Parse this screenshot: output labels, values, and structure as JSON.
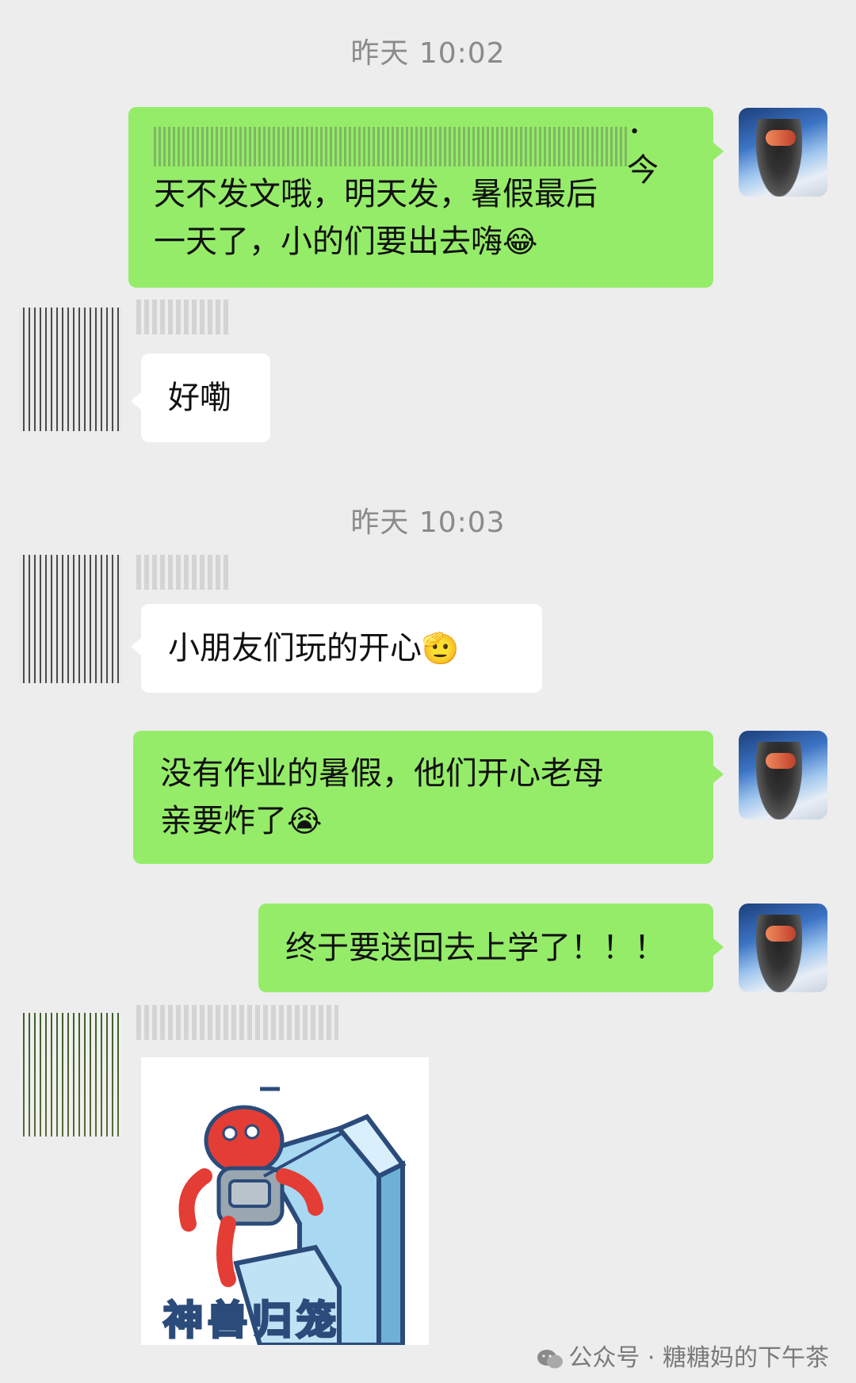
{
  "timestamps": [
    "昨天 10:02",
    "昨天 10:03"
  ],
  "messages": [
    {
      "sender": "me",
      "text": "今天不发文哦，明天发，暑假最后一天了，小的们要出去嗨",
      "lines": [
        "．今",
        "天不发文哦，明天发，暑假最后",
        "一天了，小的们要出去嗨"
      ],
      "emoji": "😂"
    },
    {
      "sender": "friend",
      "text": "好嘞"
    },
    {
      "sender": "friend",
      "text": "小朋友们玩的开心",
      "emoji": "🫡"
    },
    {
      "sender": "me",
      "lines": [
        "没有作业的暑假，他们开心老母",
        "亲要炸了"
      ],
      "emoji": "😭"
    },
    {
      "sender": "me",
      "text": "终于要送回去上学了！！！"
    },
    {
      "sender": "friend",
      "sticker_caption": "神兽归笼"
    }
  ],
  "watermark": "公众号 · 糖糖妈的下午茶"
}
